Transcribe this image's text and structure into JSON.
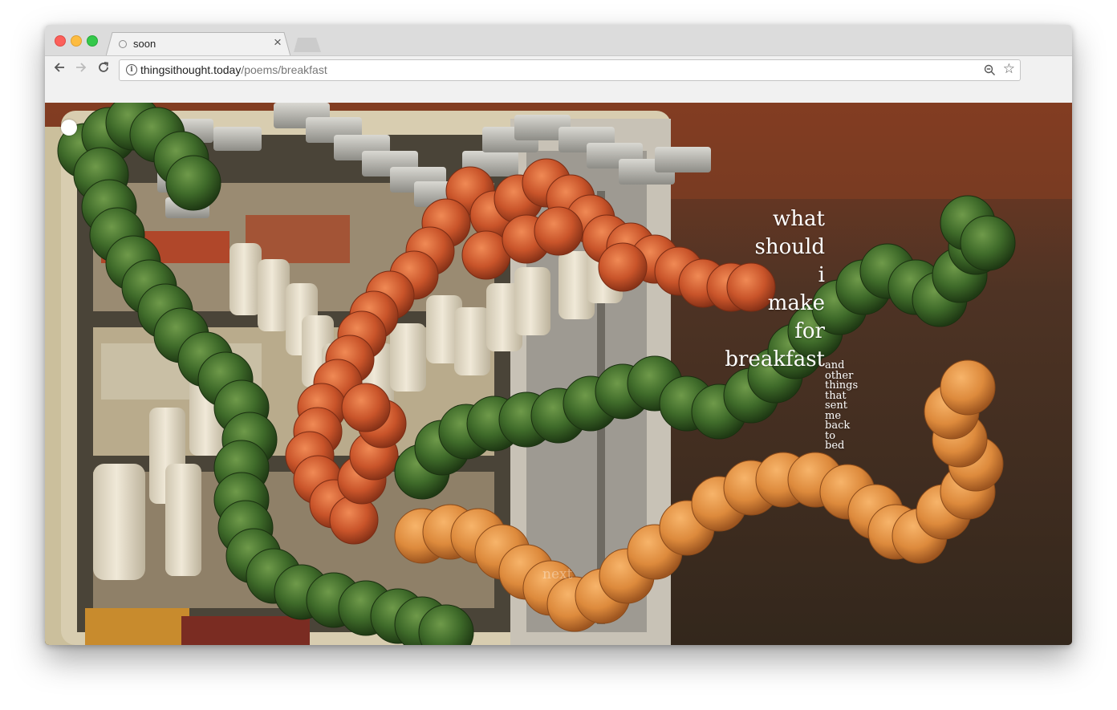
{
  "browser": {
    "tab_title": "soon",
    "url_domain": "thingsithought.today",
    "url_path": "/poems/breakfast"
  },
  "poem": {
    "title_words": [
      "what",
      "should",
      "i",
      "make",
      "for",
      "breakfast"
    ],
    "subtitle_words": [
      "and",
      "other",
      "things",
      "that",
      "sent",
      "me",
      "back",
      "to",
      "bed"
    ],
    "next_label": "next"
  },
  "icons": {
    "back": "arrow-left-icon",
    "forward": "arrow-right-icon",
    "reload": "reload-icon",
    "info": "info-icon",
    "zoom": "zoom-out-icon",
    "bookmark": "star-icon"
  },
  "colors": {
    "artichoke": "#3f6b2a",
    "tomato": "#c9542a",
    "orange": "#dd8a3c",
    "milk": "#e8e0cc",
    "background_wall": "#3a2c1f"
  }
}
